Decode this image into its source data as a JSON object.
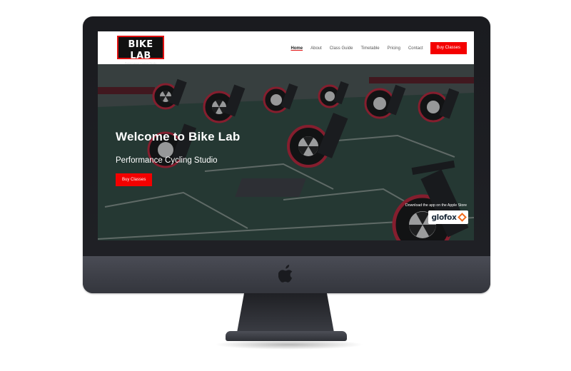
{
  "site": {
    "logo": {
      "title": "BIKE LAB",
      "subtitle": "Performance Cycling Studio"
    },
    "nav": {
      "items": [
        {
          "label": "Home",
          "active": true
        },
        {
          "label": "About"
        },
        {
          "label": "Class Guide"
        },
        {
          "label": "Timetable"
        },
        {
          "label": "Pricing"
        },
        {
          "label": "Contact"
        }
      ],
      "cta_label": "Buy Classes"
    },
    "hero": {
      "title": "Welcome to Bike Lab",
      "subtitle": "Performance Cycling Studio",
      "button_label": "Buy Classes",
      "app_text": "Download the app on the Apple Store",
      "app_badge": "glofox"
    }
  },
  "colors": {
    "accent": "#f40000",
    "bezel": "#1c1d21",
    "glofox_orange": "#f26b1d"
  },
  "icons": {
    "monitor_logo": "apple-icon",
    "badge_mark": "glofox-diamond-icon"
  }
}
